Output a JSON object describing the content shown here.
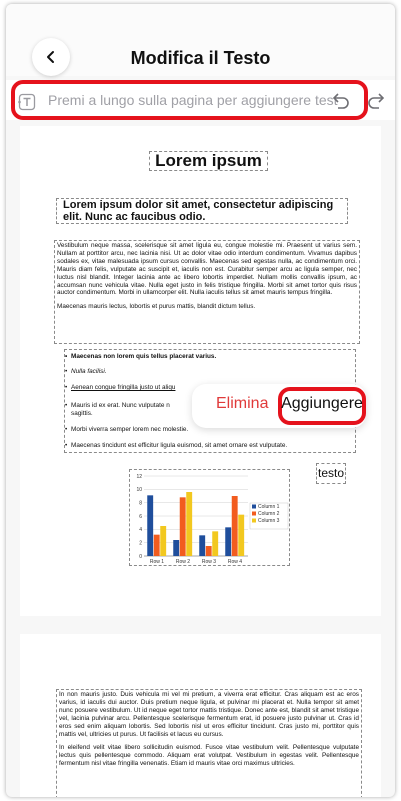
{
  "header": {
    "title": "Modifica il Testo"
  },
  "toolbar": {
    "placeholder": "Premi a lungo sulla pagina per aggiungere testo"
  },
  "document": {
    "heading1": "Lorem ipsum",
    "heading2": "Lorem ipsum dolor sit amet, consectetur adipiscing elit. Nunc ac faucibus odio.",
    "para1": "Vestibulum neque massa, scelerisque sit amet ligula eu, congue molestie mi. Praesent ut varius sem. Nullam at porttitor arcu, nec lacinia nisi. Ut ac dolor vitae odio interdum condimentum. Vivamus dapibus sodales ex, vitae malesuada ipsum cursus convallis. Maecenas sed egestas nulla, ac condimentum orci. Mauris diam felis, vulputate ac suscipit et, iaculis non est. Curabitur semper arcu ac ligula semper, nec luctus nisl blandit. Integer lacinia ante ac libero lobortis imperdiet. Nullam mollis convallis ipsum, ac accumsan nunc vehicula vitae. Nulla eget justo in felis tristique fringilla. Morbi sit amet tortor quis risus auctor condimentum. Morbi in ullamcorper elit. Nulla iaculis tellus sit amet mauris tempus fringilla.",
    "para1b": "Maecenas mauris lectus, lobortis et purus mattis, blandit dictum tellus.",
    "bullets": [
      "Maecenas non lorem quis tellus placerat varius.",
      "Nulla facilisi.",
      "Aenean congue fringilla justo ut aliqu",
      "Mauris id ex erat. Nunc vulputate n",
      "sagittis.",
      "Morbi viverra semper lorem nec molestie.",
      "Maecenas tincidunt est efficitur ligula euismod, sit amet ornare est vulputate."
    ],
    "testo_label": "testo",
    "para3": "In non mauris justo. Duis vehicula mi vel mi pretium, a viverra erat efficitur. Cras aliquam est ac eros varius, id iaculis dui auctor. Duis pretium neque ligula, et pulvinar mi placerat et. Nulla tempor sit amet nunc posuere vestibulum. Ut id neque eget tortor mattis tristique. Donec ante est, blandit sit amet tristique vel, lacinia pulvinar arcu. Pellentesque scelerisque fermentum erat, id posuere justo pulvinar ut. Cras id eros sed enim aliquam lobortis. Sed lobortis nisl ut eros efficitur tincidunt. Cras justo mi, porttitor quis mattis vel, ultricies ut purus. Ut facilisis et lacus eu cursus.",
    "para3b": "In eleifend velit vitae libero sollicitudin euismod. Fusce vitae vestibulum velit. Pellentesque vulputate lectus quis pellentesque commodo. Aliquam erat volutpat. Vestibulum in egestas velit. Pellentesque fermentum nisl vitae fringilla venenatis. Etiam id mauris vitae orci maximus ultricies."
  },
  "context_menu": {
    "delete_label": "Elimina",
    "add_label": "Aggiungere"
  },
  "colors": {
    "highlight": "#e5121c",
    "delete": "#e03a3a",
    "series1": "#1f4e9c",
    "series2": "#f25c1f",
    "series3": "#f2c81f"
  },
  "icons": {
    "back": "chevron-left-icon",
    "text_tool": "text-box-icon",
    "undo": "undo-icon",
    "redo": "redo-icon"
  },
  "chart_data": {
    "type": "bar",
    "categories": [
      "Row 1",
      "Row 2",
      "Row 3",
      "Row 4"
    ],
    "series": [
      {
        "name": "Column 1",
        "values": [
          9.1,
          2.4,
          3.1,
          4.3
        ]
      },
      {
        "name": "Column 2",
        "values": [
          3.2,
          8.8,
          1.5,
          9.0
        ]
      },
      {
        "name": "Column 3",
        "values": [
          4.5,
          9.6,
          3.7,
          6.2
        ]
      }
    ],
    "yticks": [
      "0",
      "2",
      "4",
      "6",
      "8",
      "10",
      "12"
    ],
    "ylim": [
      0,
      12
    ],
    "legend": "right",
    "grid": true
  }
}
